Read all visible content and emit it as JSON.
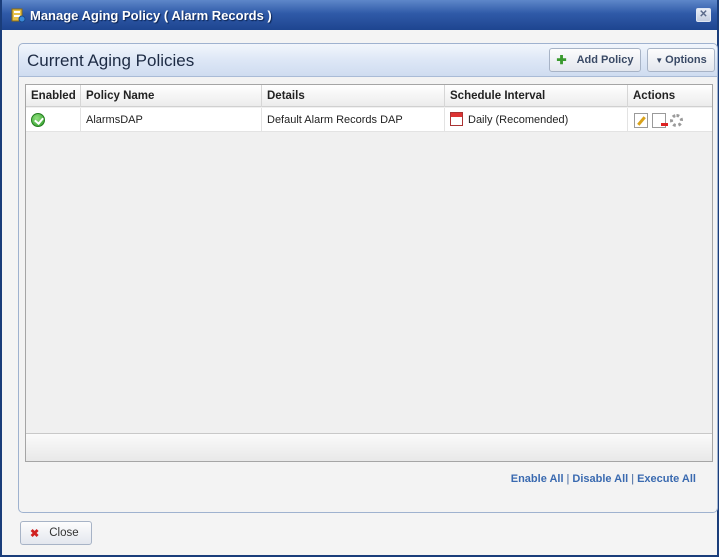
{
  "window": {
    "title": "Manage Aging Policy ( Alarm Records )",
    "close_glyph": "✕"
  },
  "panel": {
    "title": "Current Aging Policies",
    "add_policy_label": "Add Policy",
    "options_label": "Options"
  },
  "table": {
    "columns": [
      "Enabled",
      "Policy Name",
      "Details",
      "Schedule Interval",
      "Actions"
    ],
    "rows": [
      {
        "enabled": true,
        "policy_name": "AlarmsDAP",
        "details": "Default Alarm Records DAP",
        "schedule_interval": "Daily (Recomended)"
      }
    ]
  },
  "footer_links": {
    "enable_all": "Enable All",
    "disable_all": "Disable All",
    "execute_all": "Execute All",
    "separator": "|"
  },
  "close_button": {
    "label": "Close"
  },
  "icons": {
    "enabled": "check-circle-icon",
    "schedule": "calendar-icon",
    "actions": [
      "edit-icon",
      "delete-icon",
      "gear-icon"
    ]
  },
  "colors": {
    "title_bar": "#2f5aa8",
    "link": "#3a6ab0",
    "enabled_green": "#2c9a27",
    "close_x": "#d02020"
  }
}
